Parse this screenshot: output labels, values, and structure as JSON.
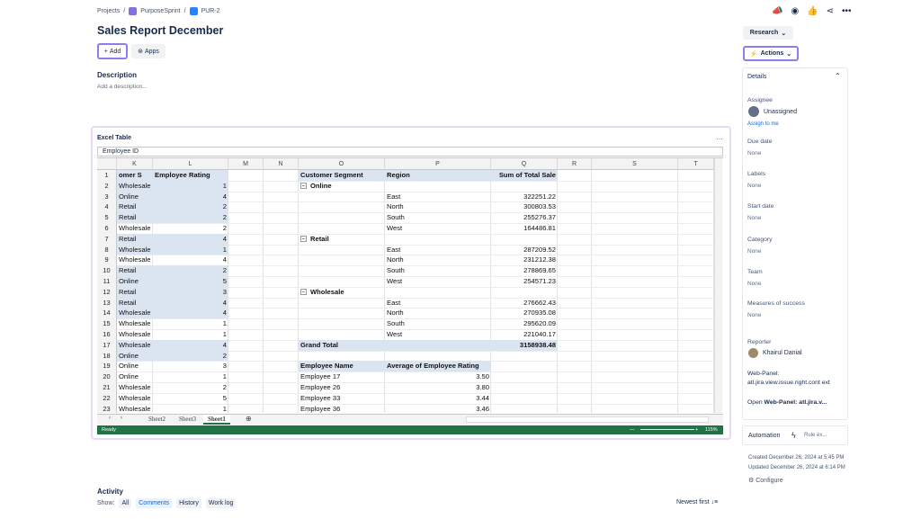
{
  "breadcrumb": {
    "projects": "Projects",
    "project": "PurposeSprint",
    "issue": "PUR-2"
  },
  "issue_title": "Sales Report December",
  "buttons": {
    "add": "Add",
    "apps": "Apps"
  },
  "description": {
    "heading": "Description",
    "placeholder": "Add a description..."
  },
  "excel": {
    "title": "Excel Table",
    "more": "…",
    "formula_value": "Employee ID",
    "columns": [
      "K",
      "L",
      "M",
      "N",
      "O",
      "P",
      "Q",
      "R",
      "S",
      "T"
    ],
    "row_numbers": [
      "1",
      "2",
      "3",
      "4",
      "5",
      "6",
      "7",
      "8",
      "9",
      "10",
      "11",
      "12",
      "13",
      "14",
      "15",
      "16",
      "17",
      "18",
      "19",
      "20",
      "21",
      "22",
      "23"
    ],
    "k_header": "omer S",
    "l_header": "Employee Rating",
    "k_values": [
      "Wholesale",
      "Online",
      "Retail",
      "Retail",
      "Wholesale",
      "Retail",
      "Wholesale",
      "Wholesale",
      "Retail",
      "Online",
      "Retail",
      "Retail",
      "Wholesale",
      "Wholesale",
      "Wholesale",
      "Wholesale",
      "Online",
      "Online",
      "Online",
      "Wholesale",
      "Wholesale",
      "Wholesale"
    ],
    "l_values": [
      "1",
      "4",
      "2",
      "2",
      "2",
      "4",
      "1",
      "4",
      "2",
      "5",
      "3",
      "4",
      "4",
      "1",
      "1",
      "4",
      "2",
      "3",
      "1",
      "2",
      "5",
      "1"
    ],
    "pivot": {
      "h_segment": "Customer Segment",
      "h_region": "Region",
      "h_sum": "Sum of Total Sale",
      "groups": [
        {
          "name": "Online",
          "rows": [
            [
              "East",
              "322251.22"
            ],
            [
              "North",
              "300803.53"
            ],
            [
              "South",
              "255276.37"
            ],
            [
              "West",
              "164486.81"
            ]
          ]
        },
        {
          "name": "Retail",
          "rows": [
            [
              "East",
              "287209.52"
            ],
            [
              "North",
              "231212.38"
            ],
            [
              "South",
              "278869.65"
            ],
            [
              "West",
              "254571.23"
            ]
          ]
        },
        {
          "name": "Wholesale",
          "rows": [
            [
              "East",
              "276662.43"
            ],
            [
              "North",
              "270935.08"
            ],
            [
              "South",
              "295620.09"
            ],
            [
              "West",
              "221040.17"
            ]
          ]
        }
      ],
      "grand_total_label": "Grand Total",
      "grand_total_value": "3158938.48"
    },
    "pivot2": {
      "h_name": "Employee Name",
      "h_avg": "Average of Employee Rating",
      "rows": [
        [
          "Employee 17",
          "3.50"
        ],
        [
          "Employee 26",
          "3.80"
        ],
        [
          "Employee 33",
          "3.44"
        ],
        [
          "Employee 36",
          "3.46"
        ]
      ]
    },
    "sheet_tabs": [
      "Sheet2",
      "Sheet3",
      "Sheet1"
    ],
    "status": "Ready",
    "zoom": "115%"
  },
  "right_panel": {
    "research": "Research",
    "actions": "Actions",
    "details": "Details",
    "assignee_label": "Assignee",
    "assignee_value": "Unassigned",
    "assign_to_me": "Assign to me",
    "due_date_label": "Due date",
    "due_date_value": "None",
    "labels_label": "Labels",
    "labels_value": "None",
    "start_date_label": "Start date",
    "start_date_value": "None",
    "category_label": "Category",
    "category_value": "None",
    "team_label": "Team",
    "team_value": "None",
    "measures_label": "Measures of success",
    "measures_value": "None",
    "reporter_label": "Reporter",
    "reporter_value": "Khairul Danial",
    "webpanel_label": "Web-Panel:",
    "webpanel_value": "atl.jira.view.issue.right.cont ext",
    "open_prefix": "Open",
    "open_link": "Web-Panel: atl.jira.v...",
    "automation": "Automation",
    "rule_exec": "Rule ex...",
    "created": "Created December 26, 2024 at 5:45 PM",
    "updated": "Updated December 26, 2024 at 6:14 PM",
    "configure": "Configure"
  },
  "activity": {
    "heading": "Activity",
    "show": "Show:",
    "filters": [
      "All",
      "Comments",
      "History",
      "Work log"
    ],
    "selected": "Comments",
    "sort": "Newest first"
  }
}
